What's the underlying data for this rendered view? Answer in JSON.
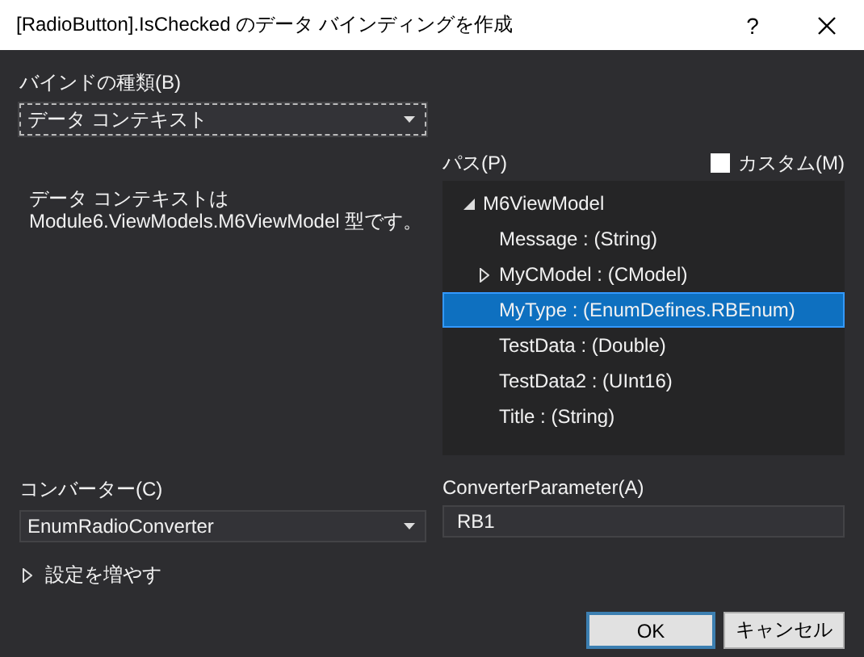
{
  "window": {
    "title": "[RadioButton].IsChecked のデータ バインディングを作成",
    "help": "?"
  },
  "binding_type": {
    "label": "バインドの種類(B)",
    "value": "データ コンテキスト"
  },
  "description": "データ コンテキストは\nModule6.ViewModels.M6ViewModel 型です。",
  "path": {
    "label": "パス(P)",
    "custom": {
      "label": "カスタム(M)",
      "checked": false
    },
    "tree": [
      {
        "label": "M6ViewModel",
        "expanded": true,
        "selected": false,
        "children": [
          {
            "label": "Message : (String)",
            "selected": false
          },
          {
            "label": "MyCModel : (CModel)",
            "expanded": false,
            "selected": false
          },
          {
            "label": "MyType : (EnumDefines.RBEnum)",
            "selected": true
          },
          {
            "label": "TestData : (Double)",
            "selected": false
          },
          {
            "label": "TestData2 : (UInt16)",
            "selected": false
          },
          {
            "label": "Title : (String)",
            "selected": false
          }
        ]
      }
    ]
  },
  "converter": {
    "label": "コンバーター(C)",
    "value": "EnumRadioConverter"
  },
  "converter_parameter": {
    "label": "ConverterParameter(A)",
    "value": "RB1"
  },
  "more_settings": {
    "label": "設定を増やす",
    "expanded": false
  },
  "buttons": [
    "OK",
    "キャンセル"
  ]
}
